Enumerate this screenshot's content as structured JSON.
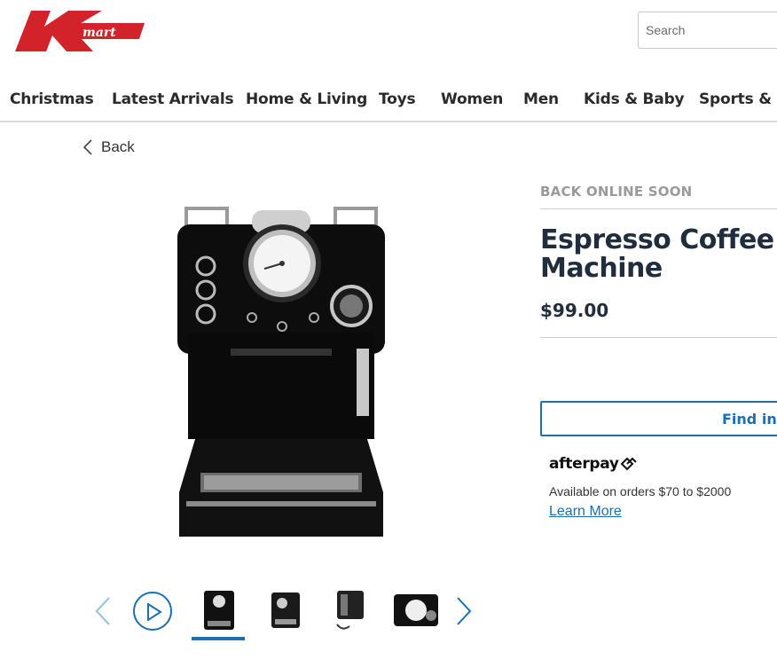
{
  "header": {
    "logo_text": "K mart",
    "search_placeholder": "Search"
  },
  "nav": {
    "items": [
      "Christmas",
      "Latest Arrivals",
      "Home & Living",
      "Toys",
      "Women",
      "Men",
      "Kids & Baby",
      "Sports & O"
    ]
  },
  "back": {
    "label": "Back"
  },
  "product": {
    "status": "BACK ONLINE SOON",
    "title": "Espresso Coffee Machine",
    "price": "$99.00",
    "find_in_store_label": "Find in s"
  },
  "afterpay": {
    "logo_text": "afterpay",
    "availability": "Available on orders $70 to $2000",
    "learn_more": "Learn More"
  },
  "carousel": {
    "thumbnail_count": 4,
    "active_index": 0
  },
  "colors": {
    "brand_red": "#d2232a",
    "accent_blue": "#1c6fb1",
    "title_navy": "#1f2d3d",
    "status_grey": "#9a9a9a"
  },
  "icons": {
    "back": "chevron-left-icon",
    "play": "play-icon",
    "prev": "chevron-left-icon",
    "next": "chevron-right-icon",
    "afterpay": "afterpay-arrows-icon"
  }
}
